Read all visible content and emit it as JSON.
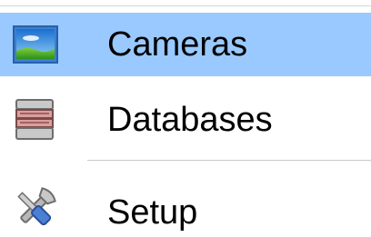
{
  "menu": {
    "items": [
      {
        "label": "Cameras",
        "icon": "camera-image-icon",
        "highlighted": true
      },
      {
        "label": "Databases",
        "icon": "database-stack-icon",
        "highlighted": false
      },
      {
        "label": "Setup",
        "icon": "tools-wrench-screwdriver-icon",
        "highlighted": false
      }
    ]
  },
  "colors": {
    "highlight": "#99c9ff",
    "separator": "#c8c8c8",
    "text": "#000000"
  }
}
